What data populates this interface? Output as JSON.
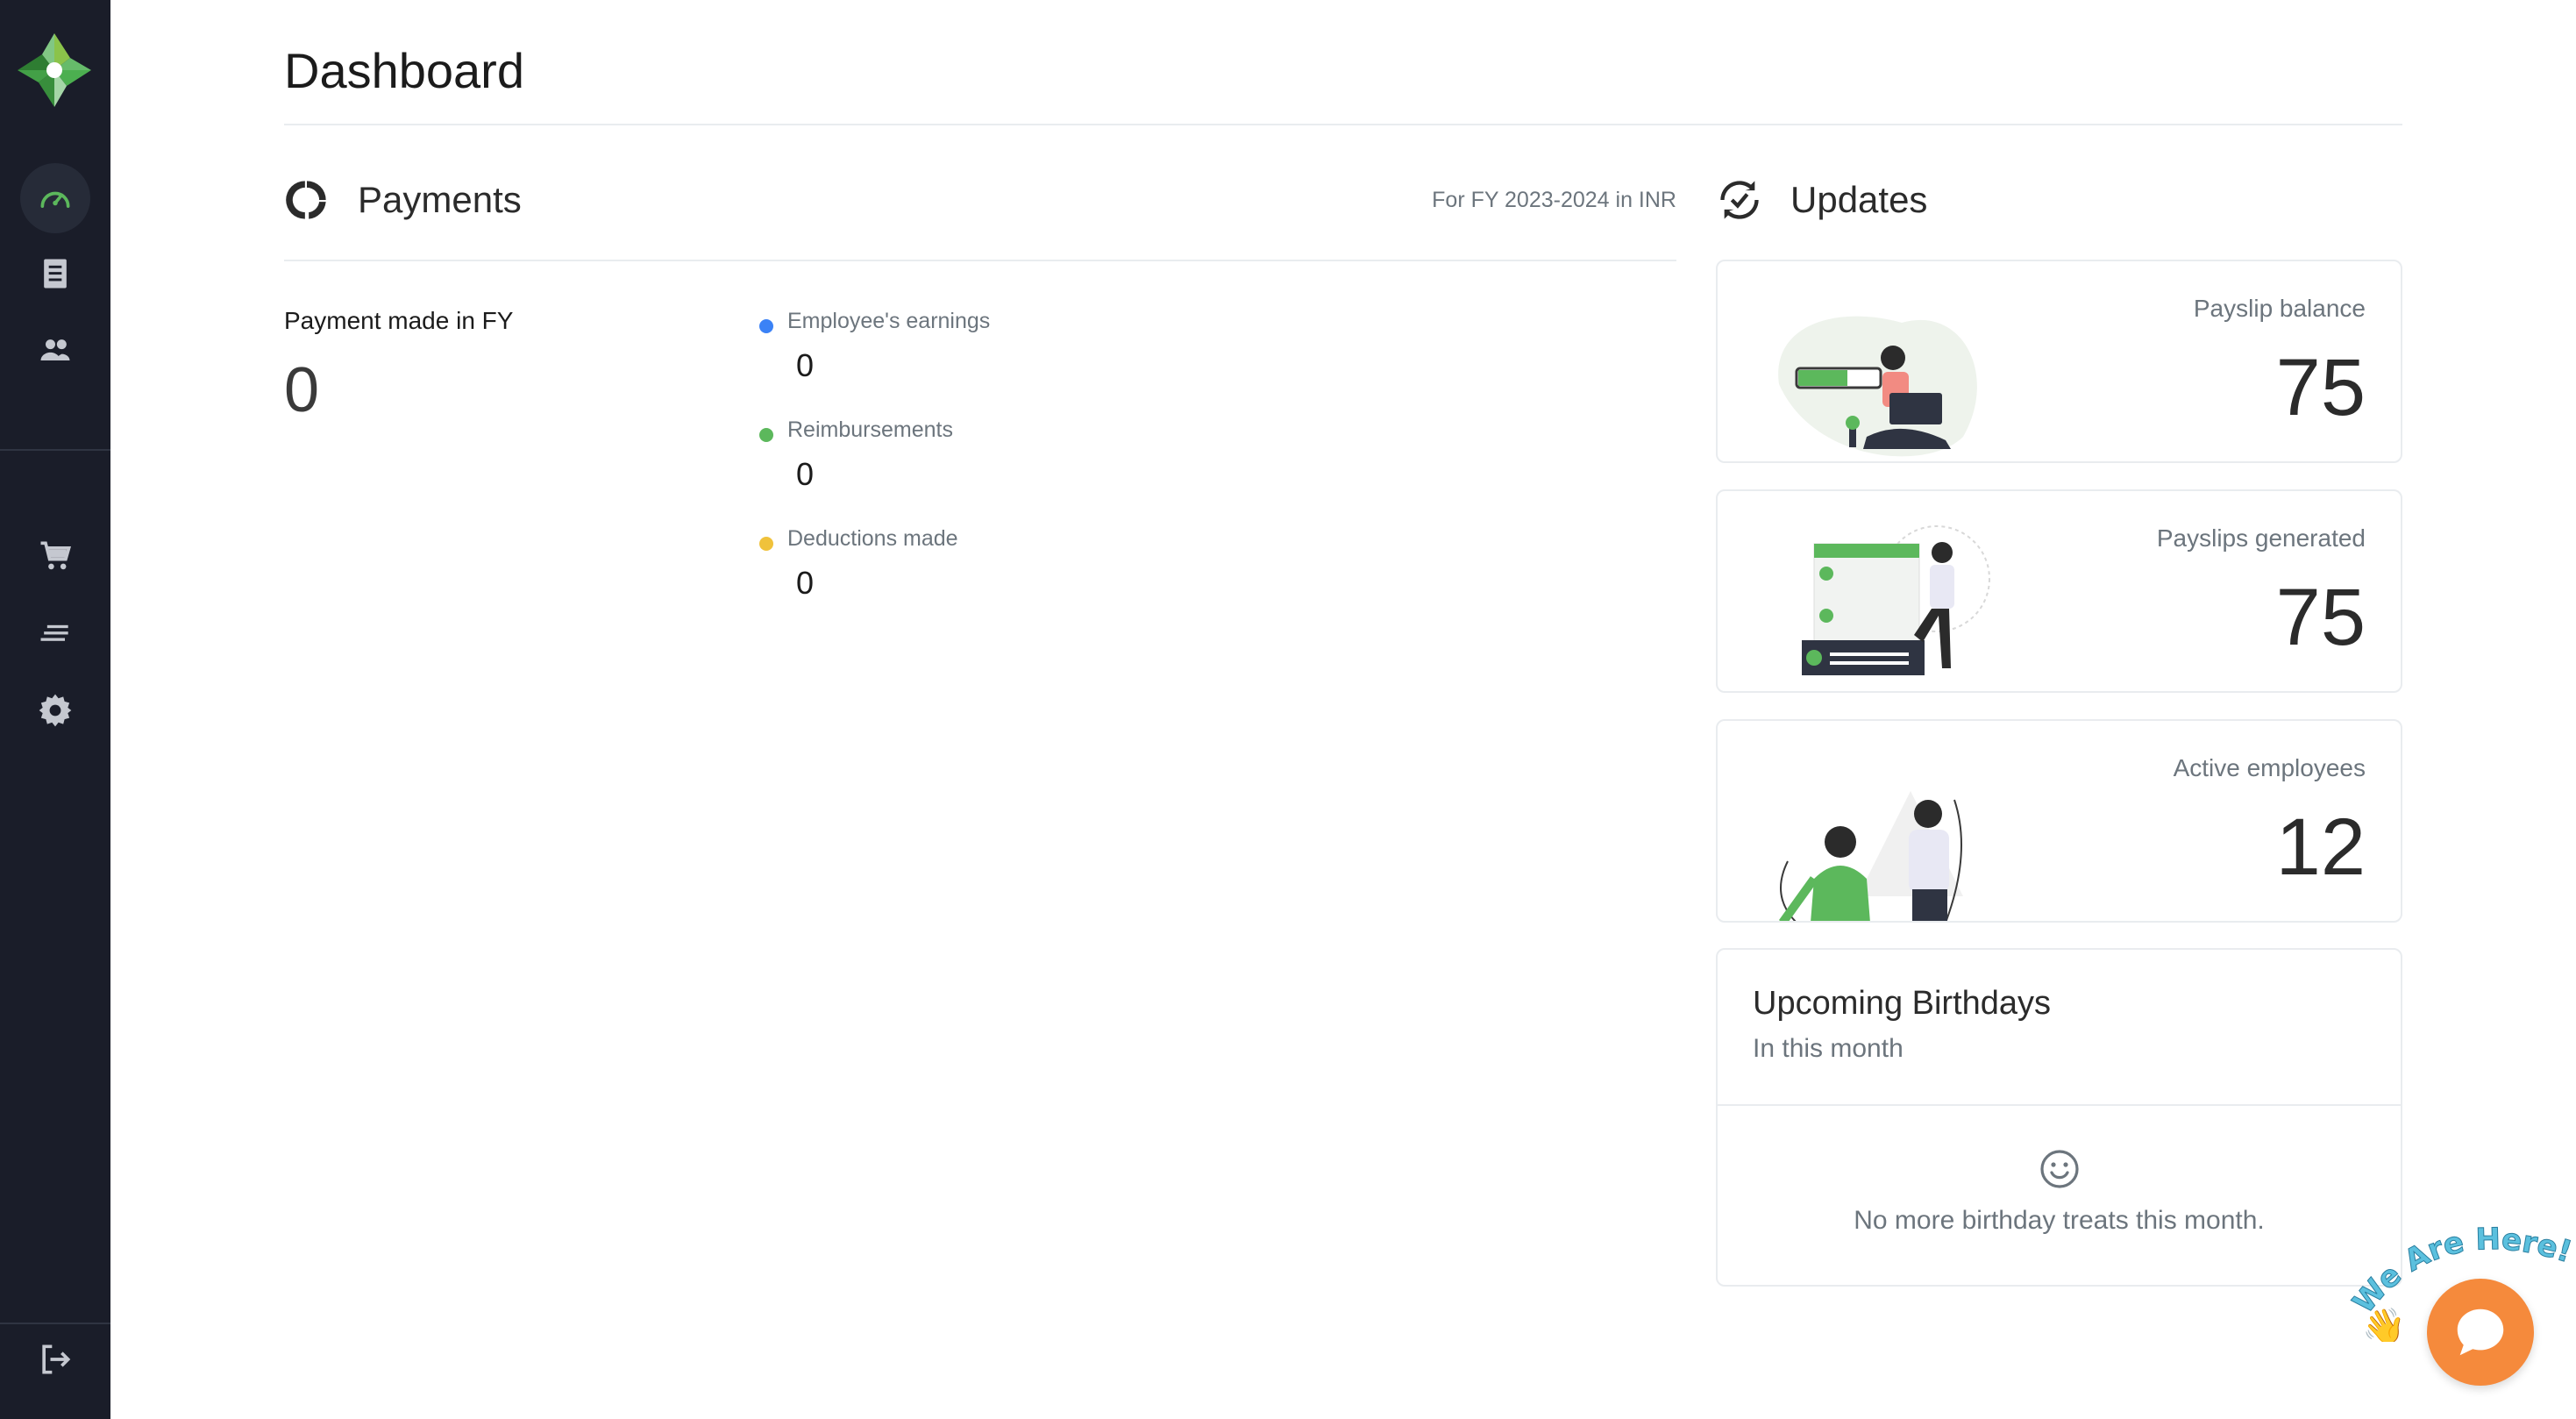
{
  "page": {
    "title": "Dashboard"
  },
  "payments": {
    "title": "Payments",
    "fy_note": "For FY 2023-2024 in INR",
    "made_label": "Payment made in FY",
    "made_value": "0",
    "breakdown": [
      {
        "label": "Employee's earnings",
        "value": "0",
        "color": "#3b82f6"
      },
      {
        "label": "Reimbursements",
        "value": "0",
        "color": "#5cb85c"
      },
      {
        "label": "Deductions made",
        "value": "0",
        "color": "#f0c23b"
      }
    ]
  },
  "updates": {
    "title": "Updates",
    "cards": [
      {
        "label": "Payslip balance",
        "value": "75"
      },
      {
        "label": "Payslips generated",
        "value": "75"
      },
      {
        "label": "Active employees",
        "value": "12"
      }
    ],
    "birthdays": {
      "title": "Upcoming Birthdays",
      "subtitle": "In this month",
      "empty_text": "No more birthday treats this month."
    }
  },
  "chat": {
    "tagline": "We Are Here!"
  },
  "colors": {
    "sidebar": "#1a1d29",
    "accent_green": "#5cb85c",
    "chat_orange": "#f58a3c"
  }
}
